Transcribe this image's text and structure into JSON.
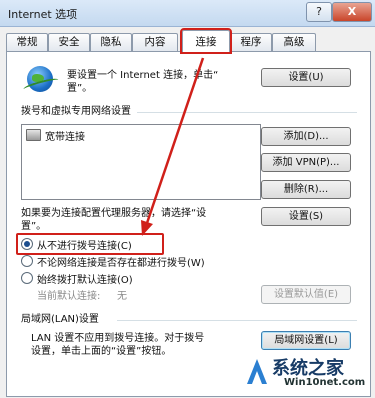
{
  "window": {
    "title": "Internet 选项",
    "help_label": "?",
    "close_label": "X"
  },
  "tabs": [
    {
      "label": "常规"
    },
    {
      "label": "安全"
    },
    {
      "label": "隐私"
    },
    {
      "label": "内容"
    },
    {
      "label": "连接",
      "active": true
    },
    {
      "label": "程序"
    },
    {
      "label": "高级"
    }
  ],
  "setup": {
    "text_line1": "要设置一个 Internet 连接，单击“",
    "text_line2": "置”。",
    "button": "设置(U)"
  },
  "dialup": {
    "heading": "拨号和虚拟专用网络设置",
    "list_items": [
      "宽带连接"
    ],
    "add_button": "添加(D)...",
    "add_vpn_button": "添加 VPN(P)...",
    "delete_button": "删除(R)...",
    "proxy_text_line1": "如果要为连接配置代理服务器，请选择“设",
    "proxy_text_line2": "置”。",
    "settings_button": "设置(S)"
  },
  "radios": [
    {
      "label": "从不进行拨号连接(C)",
      "selected": true
    },
    {
      "label": "不论网络连接是否存在都进行拨号(W)",
      "selected": false
    },
    {
      "label": "始终拨打默认连接(O)",
      "selected": false
    }
  ],
  "default_connection": {
    "label": "当前默认连接:",
    "value": "无",
    "button": "设置默认值(E)"
  },
  "lan": {
    "heading": "局域网(LAN)设置",
    "text_line1": "LAN 设置不应用到拨号连接。对于拨号",
    "text_line2": "设置，单击上面的“设置”按钮。",
    "button": "局域网设置(L)"
  },
  "watermark": {
    "title": "系统之家",
    "url": "Win10net.com"
  },
  "colors": {
    "annotation_red": "#d0201a",
    "accent_blue": "#1d4f8f"
  }
}
